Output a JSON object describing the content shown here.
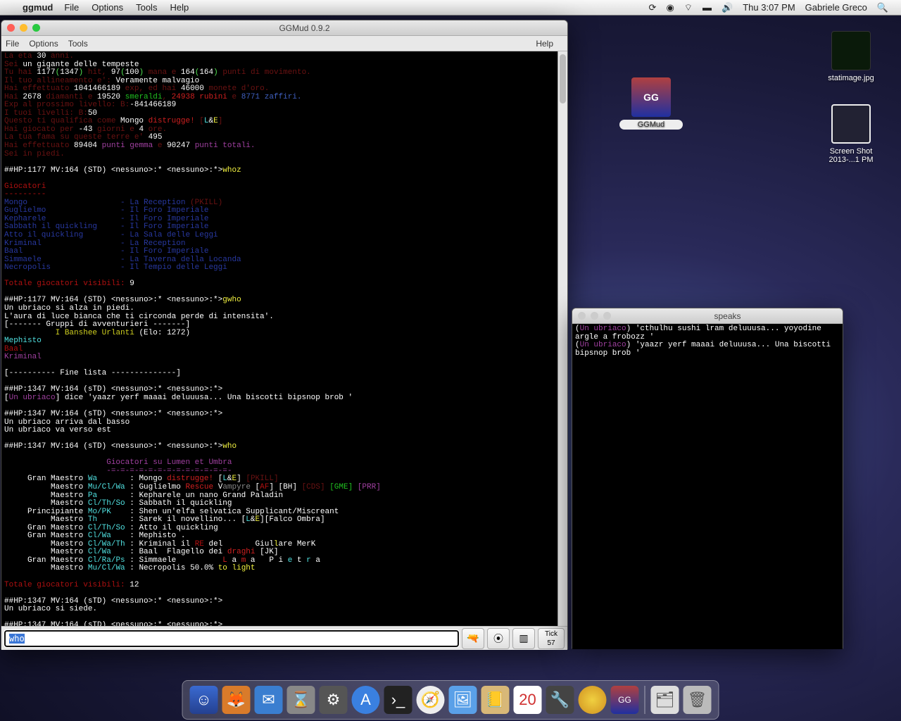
{
  "menubar": {
    "app": "ggmud",
    "items": [
      "File",
      "Options",
      "Tools",
      "Help"
    ],
    "clock": "Thu 3:07 PM",
    "user": "Gabriele Greco"
  },
  "desktop": {
    "statimage": "statimage.jpg",
    "ggmud": "GGMud",
    "screenshot_line1": "Screen Shot",
    "screenshot_line2": "2013-...1 PM"
  },
  "main_window": {
    "title": "GGMud 0.9.2",
    "toolbar": {
      "file": "File",
      "options": "Options",
      "tools": "Tools",
      "help": "Help"
    },
    "input_value": "who",
    "tick_label": "Tick",
    "tick_value": "57"
  },
  "speaks_window": {
    "title": "speaks",
    "lines": [
      "(Un ubriaco) 'cthulhu sushi lram deluuusa... yoyodine argle a frobozz '",
      "(Un ubriaco) 'yaazr yerf maaai deluuusa... Una biscotti bipsnop brob '"
    ]
  },
  "stats": {
    "eta": "30",
    "race": "un gigante delle tempeste",
    "hp_cur": "1177",
    "hp_max": "1347",
    "mana_cur": "97",
    "mana_max": "100",
    "mv_cur": "164",
    "mv_max": "164",
    "align": "Veramente malvagio",
    "exp": "1041466189",
    "gold": "46000",
    "diamanti": "2678",
    "smeraldi": "19520",
    "rubini": "24938",
    "zaffiri": "8771",
    "exp_next": "-841466189",
    "level_b": "50",
    "mongo": "Mongo",
    "distrugge": "distrugge!",
    "days": "-43",
    "hours": "4",
    "fama": "495",
    "gemma": "89404",
    "pt_tot": "90247"
  },
  "visible1": "9",
  "status_lines": {
    "s1": "##HP:1177 MV:164 (STD) <nessuno>:* <nessuno>:*>",
    "s2": "##HP:1347 MV:164 (sTD) <nessuno>:* <nessuno>:*>"
  },
  "cmd_whoz": "whoz",
  "cmd_gwho": "gwho",
  "cmd_who": "who",
  "elo": "1272",
  "group_name": "I Banshee Urlanti",
  "adv": [
    "Mephisto",
    "Baal",
    "Kriminal"
  ],
  "players": [
    {
      "n": "Mongo",
      "loc": "La Reception",
      "flag": "(PKILL)"
    },
    {
      "n": "Guglielmo",
      "loc": "Il Foro Imperiale"
    },
    {
      "n": "Kepharele",
      "loc": "Il Foro Imperiale"
    },
    {
      "n": "Sabbath il quickling",
      "loc": "Il Foro Imperiale"
    },
    {
      "n": "Atto il quickling",
      "loc": "La Sala delle Leggi"
    },
    {
      "n": "Kriminal",
      "loc": "La Reception"
    },
    {
      "n": "Baal",
      "loc": "Il Foro Imperiale"
    },
    {
      "n": "Simmaele",
      "loc": "La Taverna della Locanda"
    },
    {
      "n": "Necropolis",
      "loc": "Il Tempio delle Leggi"
    }
  ],
  "visible2": "12",
  "who_entries": [
    {
      "rank": "Gran Maestro",
      "cls": "Wa",
      "name": "Mongo",
      "extra": "distrugge! [L&E] [PKILL]"
    },
    {
      "rank": "Maestro",
      "cls": "Mu/Cl/Wa",
      "name": "Guglielmo",
      "extra": "Rescue Vampyre [AF] [BH] [CDS] [GME] [PRR]"
    },
    {
      "rank": "Maestro",
      "cls": "Pa",
      "name": "Kepharele",
      "extra": "un nano Grand Paladin"
    },
    {
      "rank": "Maestro",
      "cls": "Cl/Th/So",
      "name": "Sabbath",
      "extra": "il quickling"
    },
    {
      "rank": "Principiante",
      "cls": "Mo/PK",
      "name": "Shen",
      "extra": "un'elfa selvatica Supplicant/Miscreant"
    },
    {
      "rank": "Maestro",
      "cls": "Th",
      "name": "Sarek",
      "extra": "il novellino... [L&E][Falco Ombra]"
    },
    {
      "rank": "Gran Maestro",
      "cls": "Cl/Th/So",
      "name": "Atto",
      "extra": "il quickling"
    },
    {
      "rank": "Gran Maestro",
      "cls": "Cl/Wa",
      "name": "Mephisto",
      "extra": "."
    },
    {
      "rank": "Maestro",
      "cls": "Cl/Wa/Th",
      "name": "Kriminal",
      "extra": "il RE del       Giullare MerK"
    },
    {
      "rank": "Maestro",
      "cls": "Cl/Wa",
      "name": "Baal",
      "extra": "Flagello dei draghi [JK]"
    },
    {
      "rank": "Gran Maestro",
      "cls": "Cl/Ra/Ps",
      "name": "Simmaele",
      "extra": "         L a m a   P i e t r a"
    },
    {
      "rank": "Maestro",
      "cls": "Mu/Cl/Wa",
      "name": "Necropolis",
      "extra": "50.0% to light"
    }
  ]
}
